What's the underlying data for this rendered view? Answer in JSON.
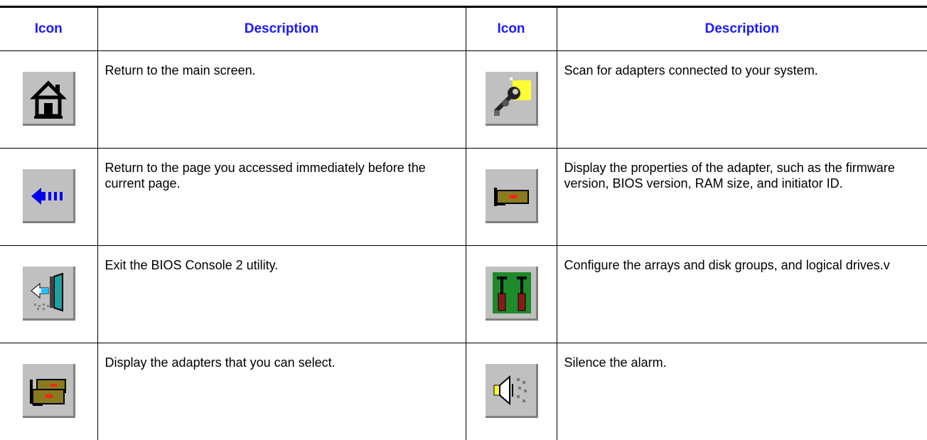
{
  "table": {
    "headers": [
      "Icon",
      "Description",
      "Icon",
      "Description"
    ],
    "rows": [
      {
        "left": {
          "icon": "home-icon",
          "description": "Return to the main screen."
        },
        "right": {
          "icon": "scan-adapters-icon",
          "description": "Scan for adapters connected to your system."
        }
      },
      {
        "left": {
          "icon": "back-arrow-icon",
          "description": "Return to the page you accessed immediately before the current page."
        },
        "right": {
          "icon": "adapter-properties-icon",
          "description": "Display the properties of the adapter, such as the firmware version, BIOS version, RAM size, and initiator ID."
        }
      },
      {
        "left": {
          "icon": "exit-door-icon",
          "description": "Exit the BIOS Console 2 utility."
        },
        "right": {
          "icon": "configure-arrays-icon",
          "description": "Configure the arrays and disk groups, and logical drives.v"
        }
      },
      {
        "left": {
          "icon": "select-adapters-icon",
          "description": "Display the adapters that you can select."
        },
        "right": {
          "icon": "silence-alarm-icon",
          "description": "Silence the alarm."
        }
      }
    ]
  },
  "colors": {
    "header_text": "#1a1aff",
    "icon_face": "#c0c0c0",
    "rule": "#000000"
  }
}
